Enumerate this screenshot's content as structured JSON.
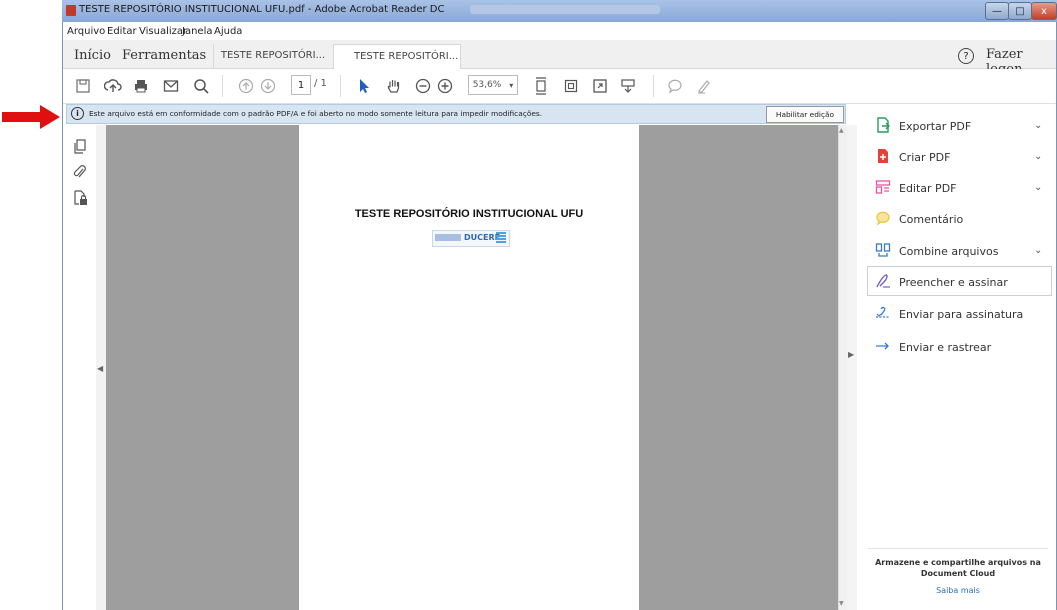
{
  "window": {
    "title": "TESTE REPOSITÓRIO INSTITUCIONAL UFU.pdf - Adobe Acrobat Reader DC",
    "controls": {
      "minimize": "—",
      "maximize": "□",
      "close": "x"
    }
  },
  "menubar": {
    "items": [
      "Arquivo",
      "Editar",
      "Visualizar",
      "Janela",
      "Ajuda"
    ]
  },
  "tabbar": {
    "home": "Início",
    "tools": "Ferramentas",
    "doc_tabs": [
      "TESTE REPOSITÓRI...",
      "TESTE REPOSITÓRI..."
    ],
    "close_glyph": "×",
    "help_glyph": "?",
    "login": "Fazer logon"
  },
  "toolbar": {
    "page_current": "1",
    "page_total": "/ 1",
    "zoom": "53,6%",
    "zoom_arrow": "▾",
    "icons": [
      "save-icon",
      "upload-icon",
      "print-icon",
      "email-icon",
      "search-icon",
      "prev-page-icon",
      "next-page-icon",
      "select-cursor-icon",
      "hand-icon",
      "zoom-out-icon",
      "zoom-in-icon",
      "fit-page-icon",
      "scroll-mode-icon",
      "fullscreen-icon",
      "read-mode-icon",
      "comment-icon",
      "sign-icon"
    ]
  },
  "infobar": {
    "icon": "i",
    "message": "Este arquivo está em conformidade com o padrão PDF/A e foi aberto no modo somente leitura para impedir modificações.",
    "button": "Habilitar edição"
  },
  "document": {
    "title": "TESTE REPOSITÓRIO INSTITUCIONAL UFU",
    "logo_text": "DUCERE"
  },
  "rightpanel": {
    "items": [
      {
        "label": "Exportar PDF",
        "icon": "export-pdf-icon",
        "chevron": "⌄",
        "color": "#2a9d5c"
      },
      {
        "label": "Criar PDF",
        "icon": "create-pdf-icon",
        "chevron": "⌄",
        "color": "#e0433a"
      },
      {
        "label": "Editar PDF",
        "icon": "edit-pdf-icon",
        "chevron": "⌄",
        "color": "#e5569a"
      },
      {
        "label": "Comentário",
        "icon": "comment-icon",
        "chevron": "",
        "color": "#f2c43a"
      },
      {
        "label": "Combine arquivos",
        "icon": "combine-files-icon",
        "chevron": "⌄",
        "color": "#3a7ad6"
      },
      {
        "label": "Preencher e assinar",
        "icon": "fill-sign-icon",
        "chevron": "",
        "color": "#7b5bc7"
      },
      {
        "label": "Enviar para assinatura",
        "icon": "send-signature-icon",
        "chevron": "",
        "color": "#3a7ad6"
      },
      {
        "label": "Enviar e rastrear",
        "icon": "send-track-icon",
        "chevron": "",
        "color": "#3a7ad6"
      }
    ],
    "cloud_text": "Armazene e compartilhe arquivos na Document Cloud",
    "cloud_link": "Saiba mais"
  }
}
